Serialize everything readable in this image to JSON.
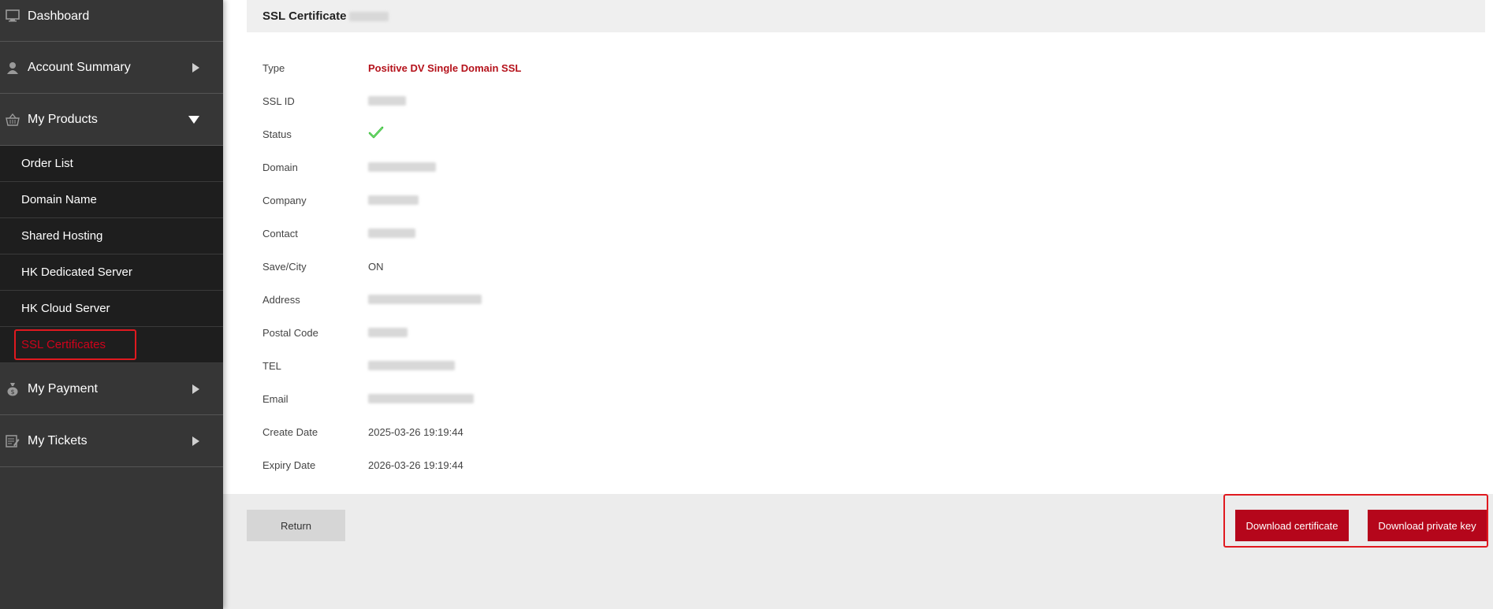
{
  "sidebar": {
    "dashboard": "Dashboard",
    "account_summary": "Account Summary",
    "my_products": "My Products",
    "products_sub": [
      "Order List",
      "Domain Name",
      "Shared Hosting",
      "HK Dedicated Server",
      "HK Cloud Server",
      "SSL Certificates"
    ],
    "my_payment": "My Payment",
    "my_tickets": "My Tickets"
  },
  "panel": {
    "title": "SSL Certificate",
    "type_label": "Type",
    "type_value": "Positive DV Single Domain SSL",
    "ssl_id_label": "SSL ID",
    "status_label": "Status",
    "domain_label": "Domain",
    "company_label": "Company",
    "contact_label": "Contact",
    "save_city_label": "Save/City",
    "save_city_value": "ON",
    "address_label": "Address",
    "postal_label": "Postal Code",
    "tel_label": "TEL",
    "email_label": "Email",
    "create_label": "Create Date",
    "create_value": "2025-03-26 19:19:44",
    "expiry_label": "Expiry Date",
    "expiry_value": "2026-03-26 19:19:44"
  },
  "actions": {
    "return": "Return",
    "download_certificate": "Download certificate",
    "download_private_key": "Download private key"
  },
  "icons": {
    "dashboard": "monitor-icon",
    "account": "user-icon",
    "products": "basket-icon",
    "payment": "money-bag-icon",
    "tickets": "ticket-edit-icon",
    "status": "check-icon"
  },
  "colors": {
    "sidebar_bg": "#363636",
    "submenu_bg": "#1e1e1e",
    "accent_red": "#b5061b",
    "highlight_red": "#e0191f",
    "status_green": "#2db82d"
  }
}
